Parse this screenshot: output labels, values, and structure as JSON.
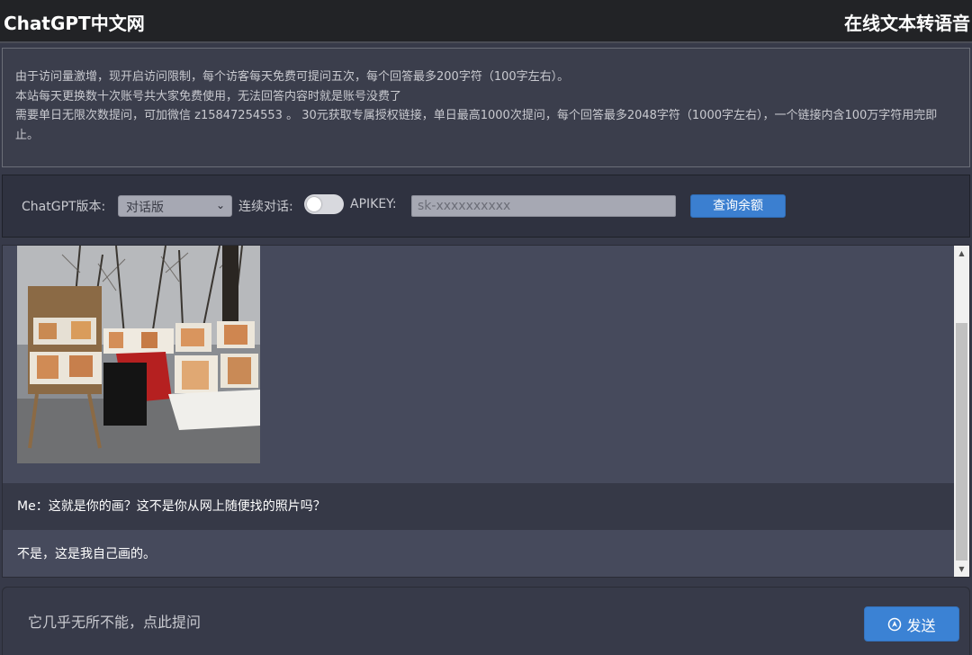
{
  "header": {
    "brand": "ChatGPT中文网",
    "tts_link": "在线文本转语音"
  },
  "notice": {
    "lines": [
      "由于访问量激增，现开启访问限制，每个访客每天免费可提问五次，每个回答最多200字符（100字左右）。",
      "本站每天更换数十次账号共大家免费使用，无法回答内容时就是账号没费了",
      "需要单日无限次数提问，可加微信 z15847254553 。 30元获取专属授权链接，单日最高1000次提问，每个回答最多2048字符（1000字左右），一个链接内含100万字符用完即止。"
    ]
  },
  "controls": {
    "version_label": "ChatGPT版本:",
    "version_value": "对话版",
    "continuous_label": "连续对话:",
    "continuous_on": false,
    "apikey_label": "APIKEY:",
    "apikey_placeholder": "sk-xxxxxxxxxx",
    "query_button": "查询余额"
  },
  "chat": {
    "messages": [
      {
        "role": "me",
        "text": "Me：这就是你的画？这不是你从网上随便找的照片吗？"
      },
      {
        "role": "assistant",
        "text": "不是，这是我自己画的。"
      }
    ]
  },
  "composer": {
    "placeholder": "它几乎无所不能，点此提问",
    "send_label": "发送"
  },
  "colors": {
    "accent": "#3b82d4",
    "background": "#373a49",
    "chat_bg": "#464a5c"
  }
}
